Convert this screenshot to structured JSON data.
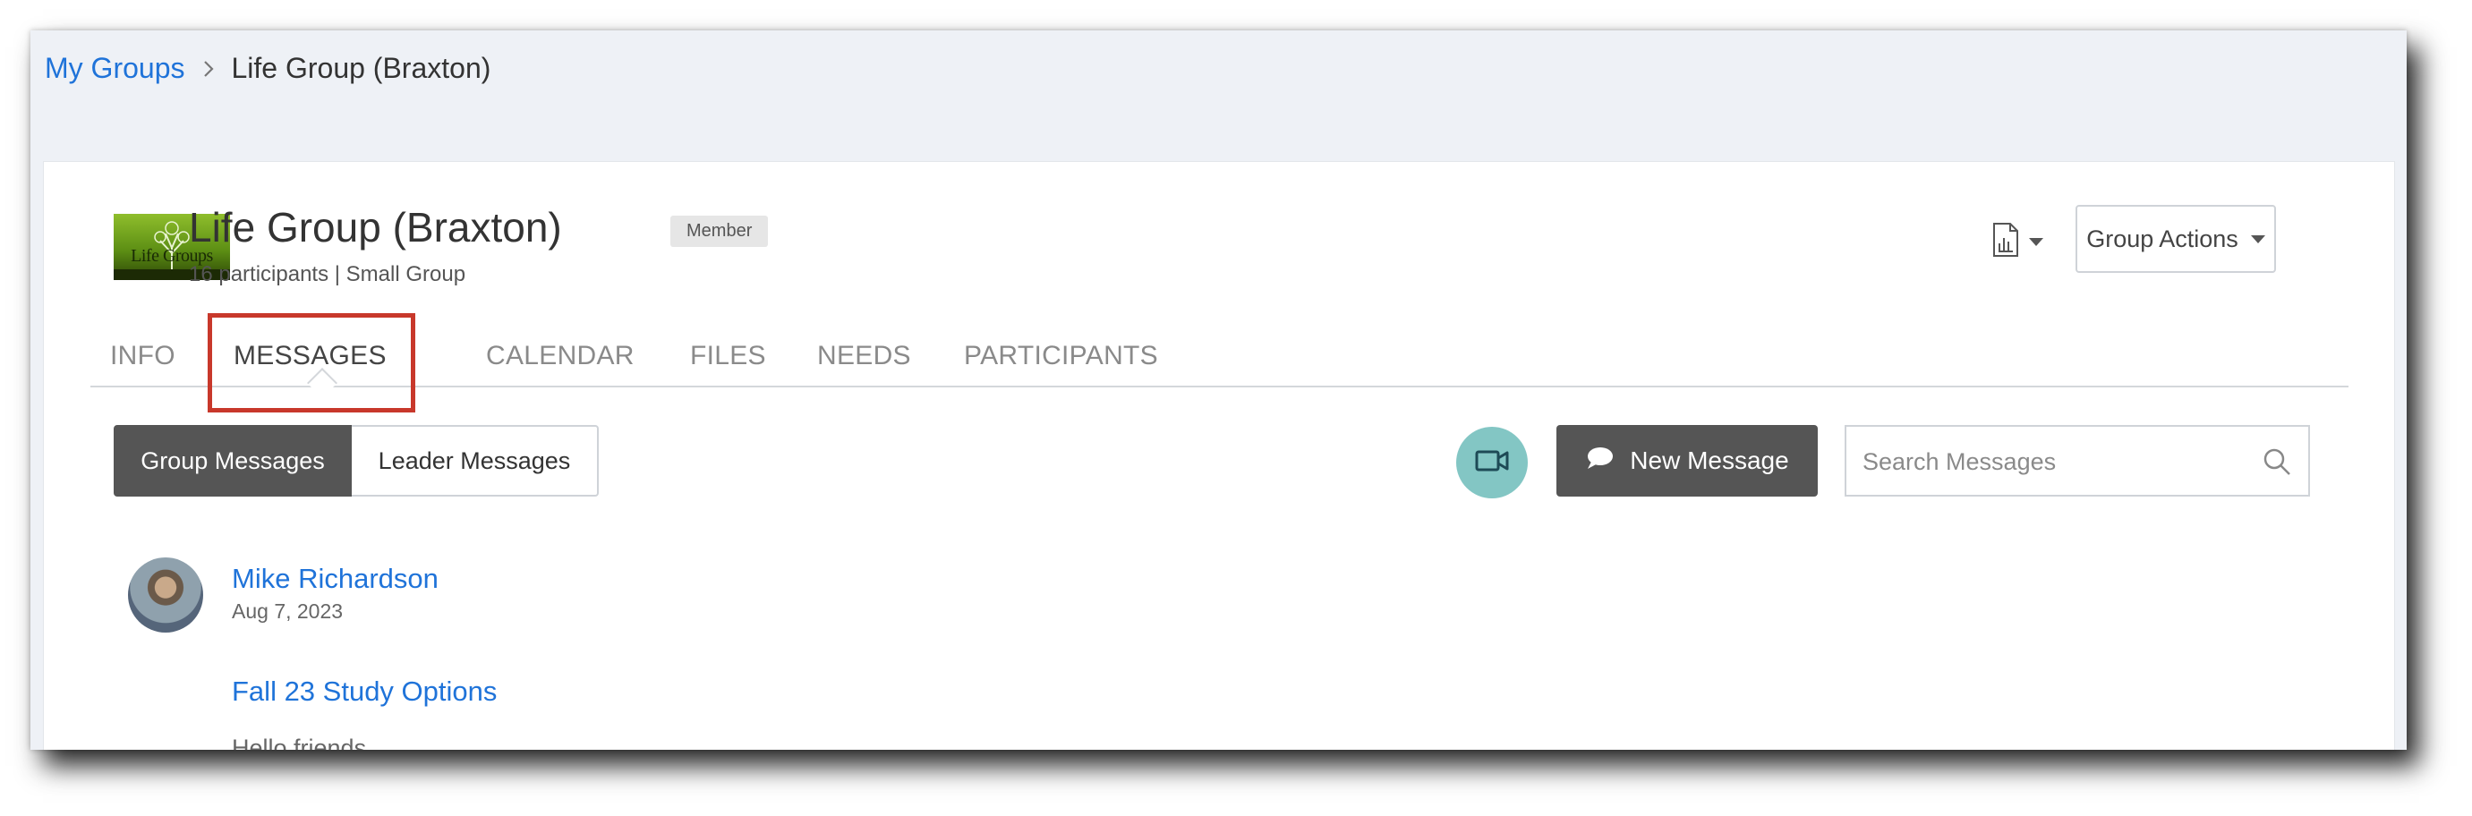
{
  "breadcrumb": {
    "root": "My Groups",
    "current": "Life Group (Braxton)"
  },
  "group": {
    "logo_text": "Life Groups",
    "title": "Life Group (Braxton)",
    "badge": "Member",
    "subtitle": "16 participants | Small Group"
  },
  "header_actions": {
    "report_icon": "document-report-icon",
    "group_actions_label": "Group Actions"
  },
  "tabs": [
    {
      "label": "INFO",
      "active": false
    },
    {
      "label": "MESSAGES",
      "active": true
    },
    {
      "label": "CALENDAR",
      "active": false
    },
    {
      "label": "FILES",
      "active": false
    },
    {
      "label": "NEEDS",
      "active": false
    },
    {
      "label": "PARTICIPANTS",
      "active": false
    }
  ],
  "message_filters": {
    "group_label": "Group Messages",
    "leader_label": "Leader Messages",
    "selected": "Group Messages"
  },
  "toolbar": {
    "video_icon": "video-camera-icon",
    "new_message_label": "New Message",
    "search_placeholder": "Search Messages",
    "search_value": ""
  },
  "messages": [
    {
      "author": "Mike Richardson",
      "date": "Aug 7, 2023",
      "title": "Fall 23 Study Options",
      "body": "Hello friends,"
    }
  ],
  "colors": {
    "link": "#1f73d9",
    "highlight": "#c8382b",
    "dark_button": "#555555",
    "video_button": "#83c6c4"
  }
}
